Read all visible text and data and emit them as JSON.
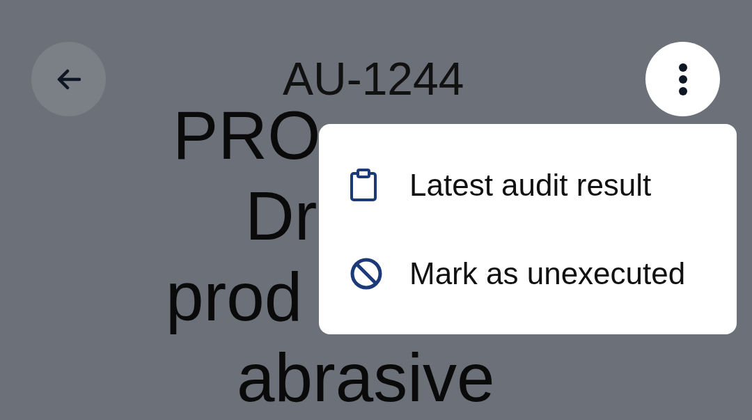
{
  "header": {
    "title": "AU-1244"
  },
  "heading_lines": [
    "PRO",
    "Dr",
    "prod",
    "abrasive"
  ],
  "menu": {
    "items": [
      {
        "kind": "clipboard",
        "label": "Latest audit result"
      },
      {
        "kind": "blocked",
        "label": "Mark as unexecuted"
      }
    ]
  }
}
